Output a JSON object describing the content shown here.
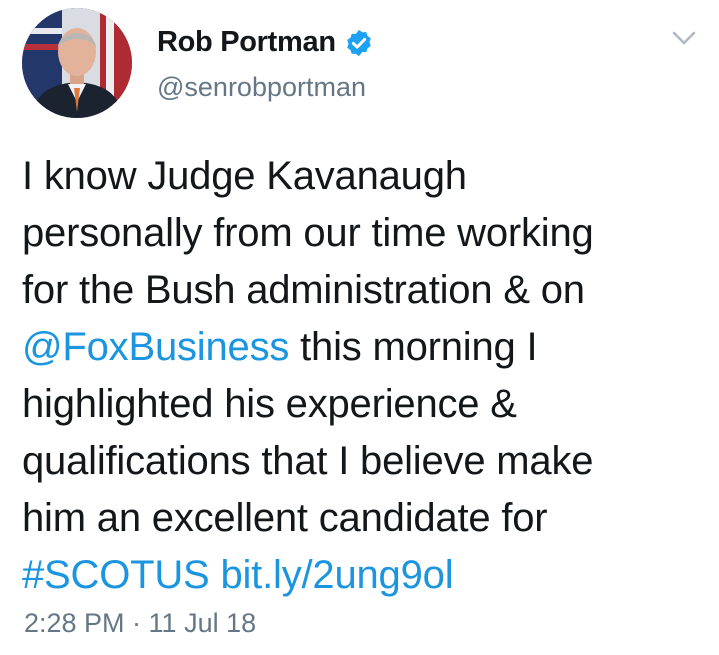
{
  "tweet": {
    "author": {
      "display_name": "Rob Portman",
      "handle": "@senrobportman",
      "verified": true,
      "verified_icon": "verified-badge-icon",
      "avatar_icon": "profile-avatar"
    },
    "menu_icon": "chevron-down-icon",
    "text": {
      "part1": "I know Judge Kavanaugh\npersonally from our time working\nfor the Bush administration & on\n",
      "mention": "@FoxBusiness",
      "part2": " this morning I\nhighlighted his experience &\nqualifications that I believe make\nhim an excellent candidate for\n",
      "hashtag": "#SCOTUS",
      "spacer": "  ",
      "link": "bit.ly/2ung9ol"
    },
    "timestamp": "2:28 PM · 11 Jul 18"
  },
  "colors": {
    "text": "#14171a",
    "link": "#1b95e0",
    "secondary": "#657786",
    "verified": "#1da1f2"
  }
}
